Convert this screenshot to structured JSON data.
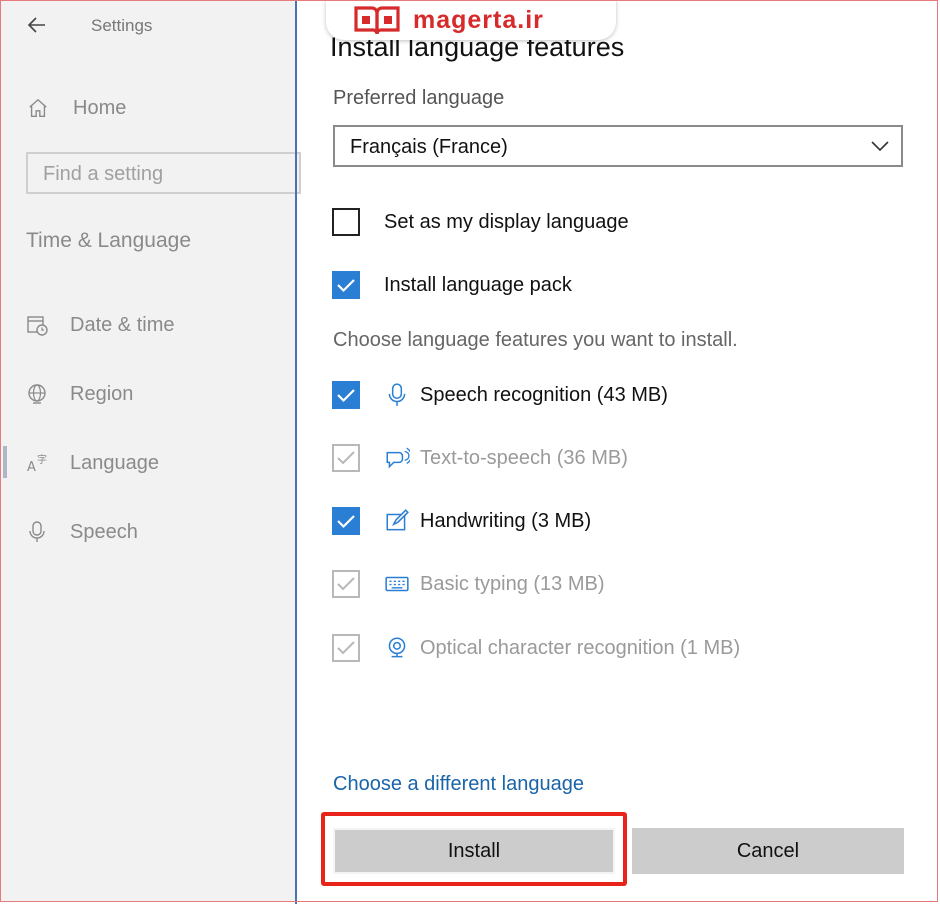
{
  "watermark": {
    "text": "magerta.ir"
  },
  "sidebar": {
    "title": "Settings",
    "home_label": "Home",
    "search_placeholder": "Find a setting",
    "section_title": "Time & Language",
    "items": [
      {
        "label": "Date & time",
        "icon": "calendar-clock-icon"
      },
      {
        "label": "Region",
        "icon": "globe-icon"
      },
      {
        "label": "Language",
        "icon": "language-icon",
        "active": true
      },
      {
        "label": "Speech",
        "icon": "microphone-icon"
      }
    ]
  },
  "dialog": {
    "title": "Install language features",
    "preferred_label": "Preferred language",
    "preferred_value": "Français (France)",
    "display_language_label": "Set as my display language",
    "language_pack_label": "Install language pack",
    "choose_features_text": "Choose language features you want to install.",
    "features": [
      {
        "label": "Speech recognition (43 MB)",
        "checked": true,
        "enabled": true,
        "icon": "microphone-icon"
      },
      {
        "label": "Text-to-speech (36 MB)",
        "checked": true,
        "enabled": false,
        "icon": "speech-bubble-icon"
      },
      {
        "label": "Handwriting (3 MB)",
        "checked": true,
        "enabled": true,
        "icon": "pen-icon"
      },
      {
        "label": "Basic typing (13 MB)",
        "checked": true,
        "enabled": false,
        "icon": "keyboard-icon"
      },
      {
        "label": "Optical character recognition (1 MB)",
        "checked": true,
        "enabled": false,
        "icon": "scanner-icon"
      }
    ],
    "different_language_link": "Choose a different language",
    "install_label": "Install",
    "cancel_label": "Cancel"
  },
  "colors": {
    "accent": "#2a7fd4",
    "link": "#1a64a8",
    "highlight": "#e8231a",
    "watermark": "#d72b2b"
  }
}
